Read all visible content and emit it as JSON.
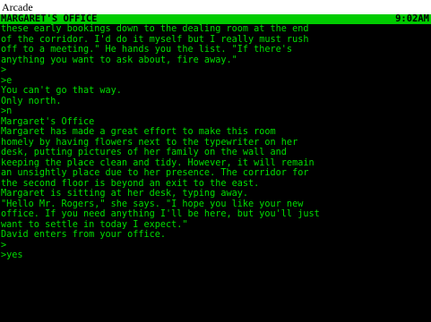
{
  "window": {
    "title": "Arcade"
  },
  "status_bar": {
    "location": "MARGARET'S OFFICE",
    "time": "9:02AM"
  },
  "transcript": [
    "these early bookings down to the dealing room at the end",
    "of the corridor. I'd do it myself but I really must rush",
    "off to a meeting.\" He hands you the list. \"If there's",
    "anything you want to ask about, fire away.\"",
    ">",
    ">e",
    "You can't go that way.",
    "Only north.",
    ">n",
    "Margaret's Office",
    "Margaret has made a great effort to make this room",
    "homely by having flowers next to the typewriter on her",
    "desk, putting pictures of her family on the wall and",
    "keeping the place clean and tidy. However, it will remain",
    "an unsightly place due to her presence. The corridor for",
    "the second floor is beyond an exit to the east.",
    "Margaret is sitting at her desk, typing away.",
    "\"Hello Mr. Rogers,\" she says. \"I hope you like your new",
    "office. If you need anything I'll be here, but you'll just",
    "want to settle in today I expect.\"",
    "David enters from your office.",
    ">",
    ">yes"
  ]
}
